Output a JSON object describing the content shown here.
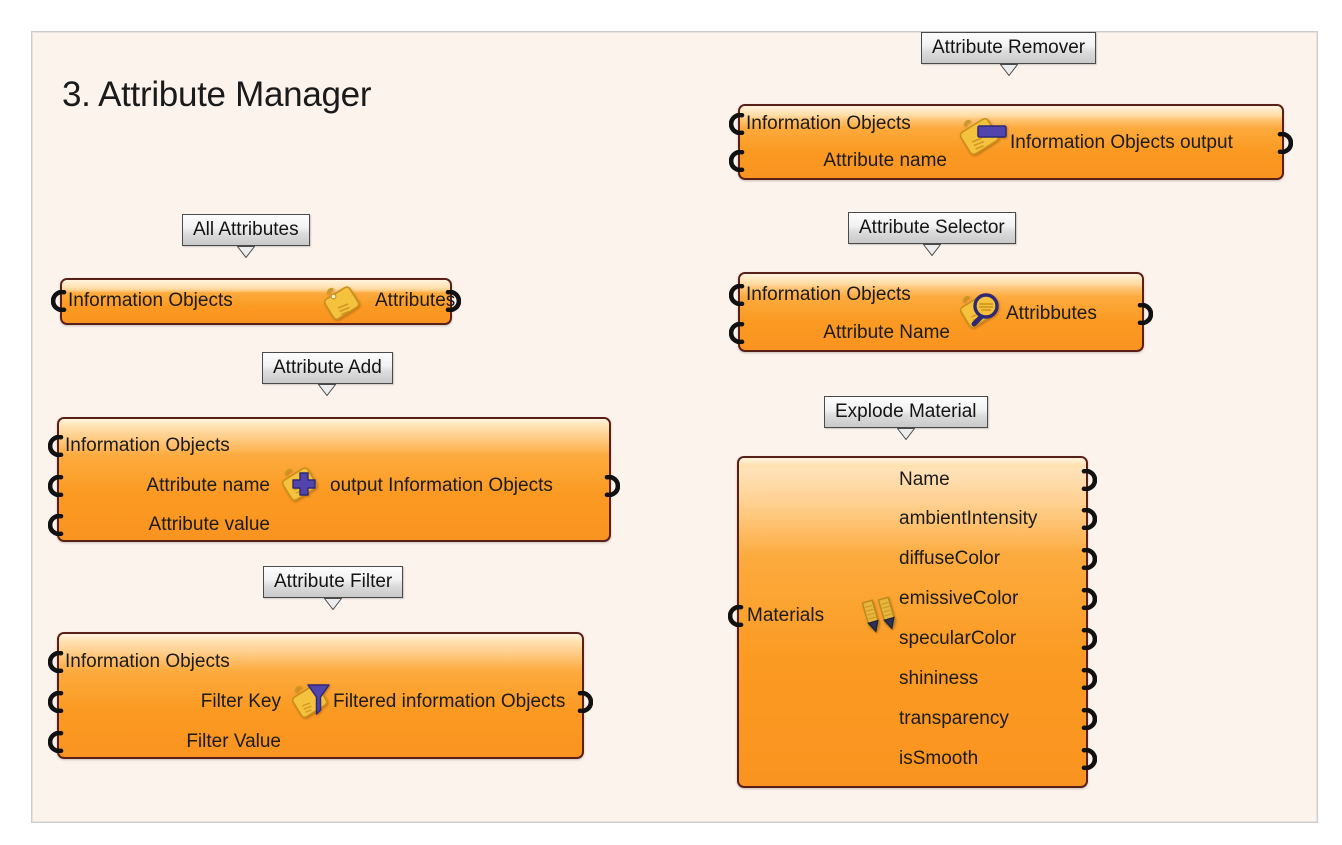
{
  "page": {
    "title": "3. Attribute Manager",
    "background": "#ffffff",
    "panel_background": "#fdf3ed",
    "panel_border": "#cfcbc8",
    "node_fill": "#fb9a22",
    "node_border": "#5a2018",
    "icon_gold": "#f0c040",
    "icon_blue": "#4a3fa8"
  },
  "nodes": [
    {
      "id": "all-attributes",
      "callout": "All Attributes",
      "icon": "tag-icon",
      "inputs": [
        "Information Objects"
      ],
      "outputs": [
        "Attributes"
      ]
    },
    {
      "id": "attribute-add",
      "callout": "Attribute Add",
      "icon": "tag-plus-icon",
      "inputs": [
        "Information Objects",
        "Attribute name",
        "Attribute value"
      ],
      "outputs": [
        "output Information Objects"
      ]
    },
    {
      "id": "attribute-filter",
      "callout": "Attribute Filter",
      "icon": "tag-funnel-icon",
      "inputs": [
        "Information Objects",
        "Filter Key",
        "Filter Value"
      ],
      "outputs": [
        "Filtered information Objects"
      ]
    },
    {
      "id": "attribute-remover",
      "callout": "Attribute Remover",
      "icon": "tag-minus-icon",
      "inputs": [
        "Information Objects",
        "Attribute name"
      ],
      "outputs": [
        "Information Objects output"
      ]
    },
    {
      "id": "attribute-selector",
      "callout": "Attribute Selector",
      "icon": "tag-magnifier-icon",
      "inputs": [
        "Information Objects",
        "Attribute Name"
      ],
      "outputs": [
        "Attribbutes"
      ]
    },
    {
      "id": "explode-material",
      "callout": "Explode Material",
      "icon": "material-pencils-icon",
      "inputs": [
        "Materials"
      ],
      "outputs": [
        "Name",
        "ambientIntensity",
        "diffuseColor",
        "emissiveColor",
        "specularColor",
        "shininess",
        "transparency",
        "isSmooth"
      ]
    }
  ]
}
